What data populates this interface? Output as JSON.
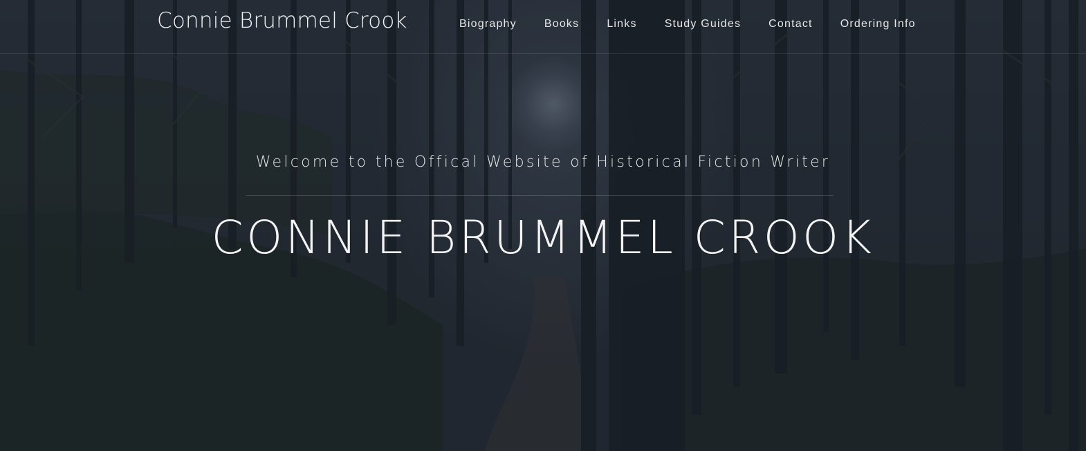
{
  "site": {
    "brand": "Connie Brummel Crook"
  },
  "nav": {
    "items": [
      {
        "label": "Biography"
      },
      {
        "label": "Books"
      },
      {
        "label": "Links"
      },
      {
        "label": "Study Guides"
      },
      {
        "label": "Contact"
      },
      {
        "label": "Ordering Info"
      }
    ]
  },
  "hero": {
    "welcome": "Welcome to the Offical Website of Historical Fiction Writer",
    "title": "CONNIE BRUMMEL CROOK",
    "background": "forest-path-image"
  },
  "colors": {
    "overlay": "#1e2430",
    "text": "#f2f2f2"
  }
}
